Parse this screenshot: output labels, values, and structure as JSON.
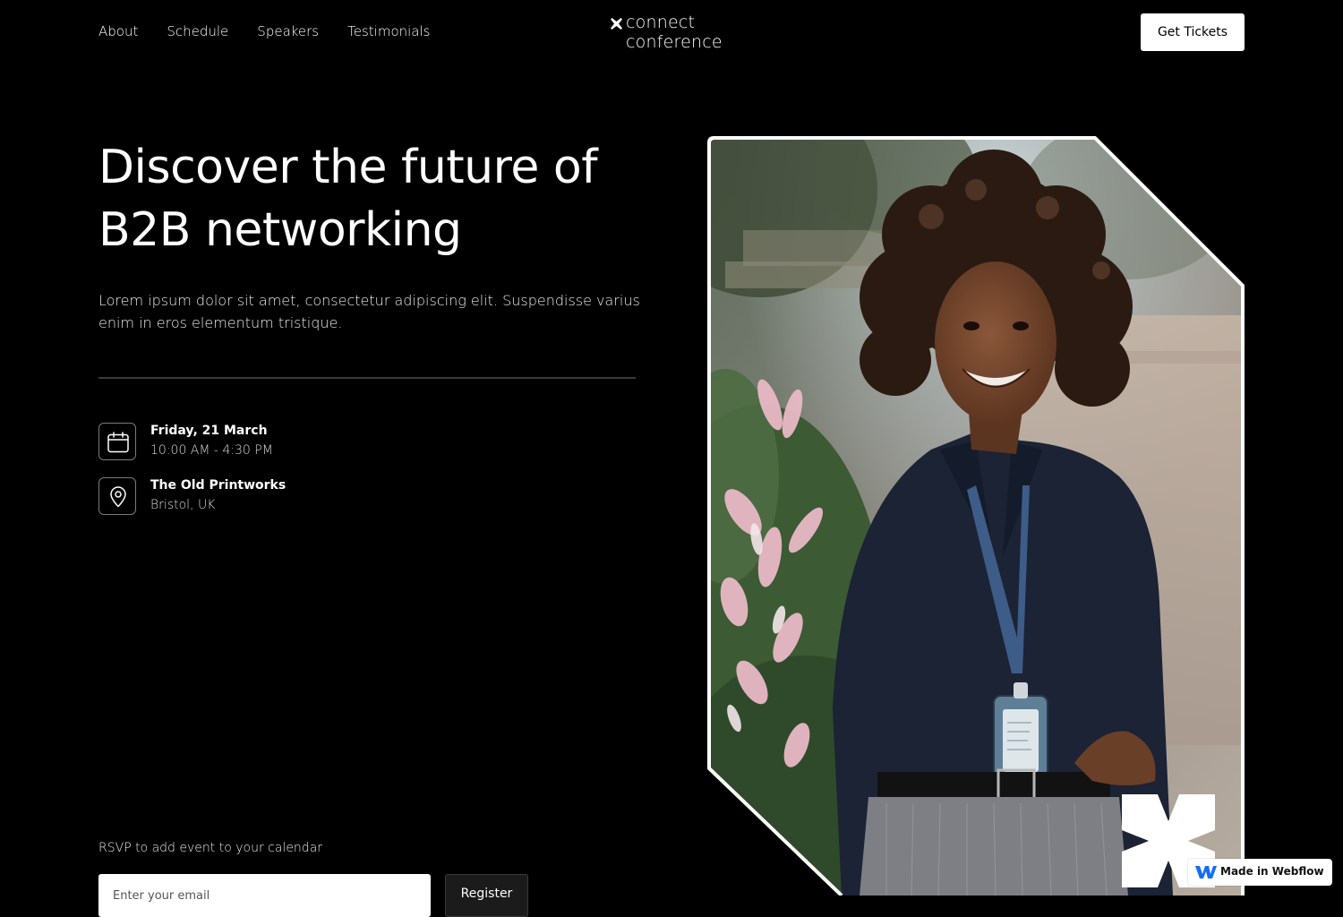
{
  "nav": {
    "links": [
      "About",
      "Schedule",
      "Speakers",
      "Testimonials"
    ],
    "cta_label": "Get Tickets"
  },
  "brand": {
    "line1": "connect",
    "line2": "conference"
  },
  "hero": {
    "title_line1": "Discover the future of",
    "title_line2": "B2B networking",
    "body": "Lorem ipsum dolor sit amet, consectetur adipiscing elit. Suspendisse varius enim in eros elementum tristique."
  },
  "event": {
    "date": "Friday, 21 March",
    "time": "10:00 AM - 4:30 PM",
    "venue": "The Old Printworks",
    "location": "Bristol, UK"
  },
  "rsvp": {
    "label": "RSVP to add event to your calendar",
    "placeholder": "Enter your email",
    "button_label": "Register"
  },
  "badge": {
    "label": "Made in Webflow"
  },
  "icons": {
    "brand": "x-mark-icon",
    "date": "calendar-icon",
    "location": "map-pin-icon",
    "badge": "webflow-logo-icon"
  },
  "colors": {
    "background": "#000000",
    "text": "#ffffff",
    "button_bg": "#ffffff",
    "frame": "#ffffff"
  }
}
